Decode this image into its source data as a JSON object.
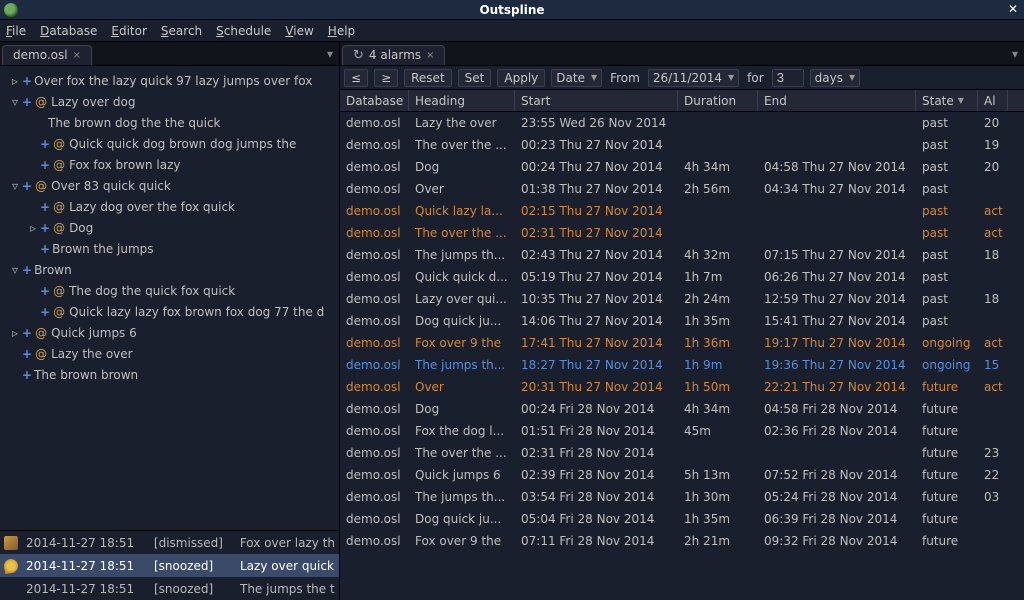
{
  "app": {
    "title": "Outspline"
  },
  "menu": [
    "File",
    "Database",
    "Editor",
    "Search",
    "Schedule",
    "View",
    "Help"
  ],
  "left_tab": "demo.osl",
  "right_tab": "4 alarms",
  "tree": [
    {
      "indent": 0,
      "tri": "▹",
      "plus": true,
      "at": false,
      "text": "Over fox the lazy quick 97 lazy jumps over fox"
    },
    {
      "indent": 0,
      "tri": "▿",
      "plus": true,
      "at": true,
      "text": "Lazy over dog"
    },
    {
      "indent": 1,
      "tri": "",
      "plus": false,
      "at": false,
      "text": "The brown dog the the quick"
    },
    {
      "indent": 1,
      "tri": "",
      "plus": true,
      "at": true,
      "text": "Quick quick dog brown dog jumps the"
    },
    {
      "indent": 1,
      "tri": "",
      "plus": true,
      "at": true,
      "text": "Fox fox brown lazy"
    },
    {
      "indent": 0,
      "tri": "▿",
      "plus": true,
      "at": true,
      "text": "Over 83 quick quick"
    },
    {
      "indent": 1,
      "tri": "",
      "plus": true,
      "at": true,
      "text": "Lazy dog over the fox quick"
    },
    {
      "indent": 1,
      "tri": "▹",
      "plus": true,
      "at": true,
      "text": "Dog"
    },
    {
      "indent": 1,
      "tri": "",
      "plus": true,
      "at": false,
      "text": "Brown the jumps"
    },
    {
      "indent": 0,
      "tri": "▿",
      "plus": true,
      "at": false,
      "text": "Brown"
    },
    {
      "indent": 1,
      "tri": "",
      "plus": true,
      "at": true,
      "text": "The dog the quick fox quick"
    },
    {
      "indent": 1,
      "tri": "",
      "plus": true,
      "at": true,
      "text": "Quick lazy lazy fox brown fox dog 77 the d"
    },
    {
      "indent": 0,
      "tri": "▹",
      "plus": true,
      "at": true,
      "text": "Quick jumps 6"
    },
    {
      "indent": 0,
      "tri": "",
      "plus": true,
      "at": true,
      "text": "Lazy the over"
    },
    {
      "indent": 0,
      "tri": "",
      "plus": true,
      "at": false,
      "text": "The brown brown"
    }
  ],
  "notifications": [
    {
      "icon": "dismissed",
      "time": "2014-11-27 18:51",
      "status": "[dismissed]",
      "text": "Fox over lazy th",
      "selected": false
    },
    {
      "icon": "snoozed",
      "time": "2014-11-27 18:51",
      "status": "[snoozed]",
      "text": "Lazy over quick",
      "selected": true
    },
    {
      "icon": "",
      "time": "2014-11-27 18:51",
      "status": "[snoozed]",
      "text": "The jumps the t",
      "selected": false
    }
  ],
  "toolbar": {
    "le": "≤",
    "ge": "≥",
    "reset": "Reset",
    "set": "Set",
    "apply": "Apply",
    "field": "Date",
    "from": "From",
    "date": "26/11/2014",
    "for": "for",
    "count": "3",
    "unit": "days"
  },
  "columns": [
    "Database",
    "Heading",
    "Start",
    "Duration",
    "End",
    "State",
    "Al"
  ],
  "rows": [
    {
      "db": "demo.osl",
      "hd": "Lazy the over",
      "st": "23:55 Wed 26 Nov 2014",
      "du": "",
      "en": "",
      "state": "past",
      "al": "20",
      "c": "normal"
    },
    {
      "db": "demo.osl",
      "hd": "The over the ...",
      "st": "00:23 Thu 27 Nov 2014",
      "du": "",
      "en": "",
      "state": "past",
      "al": "19",
      "c": "normal"
    },
    {
      "db": "demo.osl",
      "hd": "Dog",
      "st": "00:24 Thu 27 Nov 2014",
      "du": "4h 34m",
      "en": "04:58 Thu 27 Nov 2014",
      "state": "past",
      "al": "20",
      "c": "normal"
    },
    {
      "db": "demo.osl",
      "hd": "Over",
      "st": "01:38 Thu 27 Nov 2014",
      "du": "2h 56m",
      "en": "04:34 Thu 27 Nov 2014",
      "state": "past",
      "al": "",
      "c": "normal"
    },
    {
      "db": "demo.osl",
      "hd": "Quick lazy la...",
      "st": "02:15 Thu 27 Nov 2014",
      "du": "",
      "en": "",
      "state": "past",
      "al": "act",
      "c": "orange"
    },
    {
      "db": "demo.osl",
      "hd": "The over the ...",
      "st": "02:31 Thu 27 Nov 2014",
      "du": "",
      "en": "",
      "state": "past",
      "al": "act",
      "c": "orange"
    },
    {
      "db": "demo.osl",
      "hd": "The jumps th...",
      "st": "02:43 Thu 27 Nov 2014",
      "du": "4h 32m",
      "en": "07:15 Thu 27 Nov 2014",
      "state": "past",
      "al": "18",
      "c": "normal"
    },
    {
      "db": "demo.osl",
      "hd": "Quick quick d...",
      "st": "05:19 Thu 27 Nov 2014",
      "du": "1h 7m",
      "en": "06:26 Thu 27 Nov 2014",
      "state": "past",
      "al": "",
      "c": "normal"
    },
    {
      "db": "demo.osl",
      "hd": "Lazy over qui...",
      "st": "10:35 Thu 27 Nov 2014",
      "du": "2h 24m",
      "en": "12:59 Thu 27 Nov 2014",
      "state": "past",
      "al": "18",
      "c": "normal"
    },
    {
      "db": "demo.osl",
      "hd": "Dog quick ju...",
      "st": "14:06 Thu 27 Nov 2014",
      "du": "1h 35m",
      "en": "15:41 Thu 27 Nov 2014",
      "state": "past",
      "al": "",
      "c": "normal"
    },
    {
      "db": "demo.osl",
      "hd": "Fox over 9 the",
      "st": "17:41 Thu 27 Nov 2014",
      "du": "1h 36m",
      "en": "19:17 Thu 27 Nov 2014",
      "state": "ongoing",
      "al": "act",
      "c": "orange"
    },
    {
      "db": "demo.osl",
      "hd": "The jumps th...",
      "st": "18:27 Thu 27 Nov 2014",
      "du": "1h 9m",
      "en": "19:36 Thu 27 Nov 2014",
      "state": "ongoing",
      "al": "15",
      "c": "blue"
    },
    {
      "db": "demo.osl",
      "hd": "Over",
      "st": "20:31 Thu 27 Nov 2014",
      "du": "1h 50m",
      "en": "22:21 Thu 27 Nov 2014",
      "state": "future",
      "al": "act",
      "c": "orange"
    },
    {
      "db": "demo.osl",
      "hd": "Dog",
      "st": "00:24 Fri 28 Nov 2014",
      "du": "4h 34m",
      "en": "04:58 Fri 28 Nov 2014",
      "state": "future",
      "al": "",
      "c": "normal"
    },
    {
      "db": "demo.osl",
      "hd": "Fox the dog l...",
      "st": "01:51 Fri 28 Nov 2014",
      "du": "45m",
      "en": "02:36 Fri 28 Nov 2014",
      "state": "future",
      "al": "",
      "c": "normal"
    },
    {
      "db": "demo.osl",
      "hd": "The over the ...",
      "st": "02:31 Fri 28 Nov 2014",
      "du": "",
      "en": "",
      "state": "future",
      "al": "23",
      "c": "normal"
    },
    {
      "db": "demo.osl",
      "hd": "Quick jumps 6",
      "st": "02:39 Fri 28 Nov 2014",
      "du": "5h 13m",
      "en": "07:52 Fri 28 Nov 2014",
      "state": "future",
      "al": "22",
      "c": "normal"
    },
    {
      "db": "demo.osl",
      "hd": "The jumps th...",
      "st": "03:54 Fri 28 Nov 2014",
      "du": "1h 30m",
      "en": "05:24 Fri 28 Nov 2014",
      "state": "future",
      "al": "03",
      "c": "normal"
    },
    {
      "db": "demo.osl",
      "hd": "Dog quick ju...",
      "st": "05:04 Fri 28 Nov 2014",
      "du": "1h 35m",
      "en": "06:39 Fri 28 Nov 2014",
      "state": "future",
      "al": "",
      "c": "normal"
    },
    {
      "db": "demo.osl",
      "hd": "Fox over 9 the",
      "st": "07:11 Fri 28 Nov 2014",
      "du": "2h 21m",
      "en": "09:32 Fri 28 Nov 2014",
      "state": "future",
      "al": "",
      "c": "normal"
    }
  ]
}
